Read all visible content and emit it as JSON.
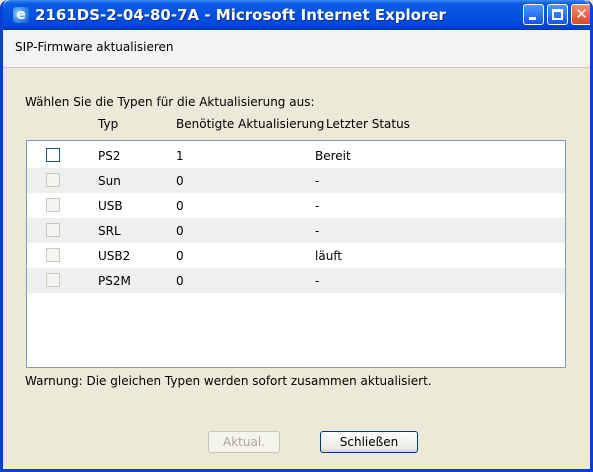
{
  "window": {
    "title": "2161DS-2-04-80-7A - Microsoft Internet Explorer",
    "icon": "ie-icon",
    "controls": {
      "minimize": "minimize-icon",
      "maximize": "maximize-icon",
      "close": "close-icon"
    }
  },
  "header": {
    "title": "SIP-Firmware aktualisieren"
  },
  "instruction": "Wählen Sie die Typen für die Aktualisierung aus:",
  "table": {
    "columns": {
      "type": "Typ",
      "update": "Benötigte Aktualisierung",
      "status": "Letzter Status"
    },
    "rows": [
      {
        "type": "PS2",
        "update": "1",
        "status": "Bereit",
        "checkbox_enabled": true,
        "checked": false
      },
      {
        "type": "Sun",
        "update": "0",
        "status": "-",
        "checkbox_enabled": false,
        "checked": false
      },
      {
        "type": "USB",
        "update": "0",
        "status": "-",
        "checkbox_enabled": false,
        "checked": false
      },
      {
        "type": "SRL",
        "update": "0",
        "status": "-",
        "checkbox_enabled": false,
        "checked": false
      },
      {
        "type": "USB2",
        "update": "0",
        "status": "läuft",
        "checkbox_enabled": false,
        "checked": false
      },
      {
        "type": "PS2M",
        "update": "0",
        "status": "-",
        "checkbox_enabled": false,
        "checked": false
      }
    ]
  },
  "warning": "Warnung: Die gleichen Typen werden sofort zusammen aktualisiert.",
  "buttons": {
    "update": "Aktual.",
    "close": "Schließen"
  },
  "colors": {
    "titlebar": "#0453e0",
    "dialog_bg": "#ece9d8",
    "list_alt_row": "#efefef"
  }
}
